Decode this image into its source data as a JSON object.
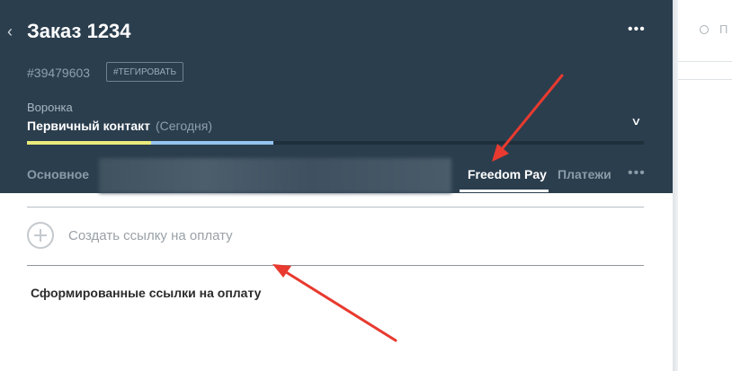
{
  "header": {
    "title": "Заказ 1234",
    "order_id": "#39479603",
    "tag_button": "#ТЕГИРОВАТЬ",
    "pipeline_label": "Воронка",
    "stage_name": "Первичный контакт",
    "stage_date": "(Сегодня)",
    "more_label": "•••"
  },
  "tabs": [
    {
      "label": "Основное"
    },
    {
      "label": "Freedom Pay"
    },
    {
      "label": "Платежи"
    }
  ],
  "tabs_more": "•••",
  "content": {
    "create_link_label": "Создать ссылку на оплату",
    "section_title": "Сформированные ссылки на оплату"
  },
  "right_panel": {
    "search_placeholder": "П"
  },
  "colors": {
    "header_bg": "#2b3e4e",
    "progress_yellow": "#ebea7c",
    "progress_blue": "#94c4ef",
    "arrow_red": "#e83a2f"
  }
}
